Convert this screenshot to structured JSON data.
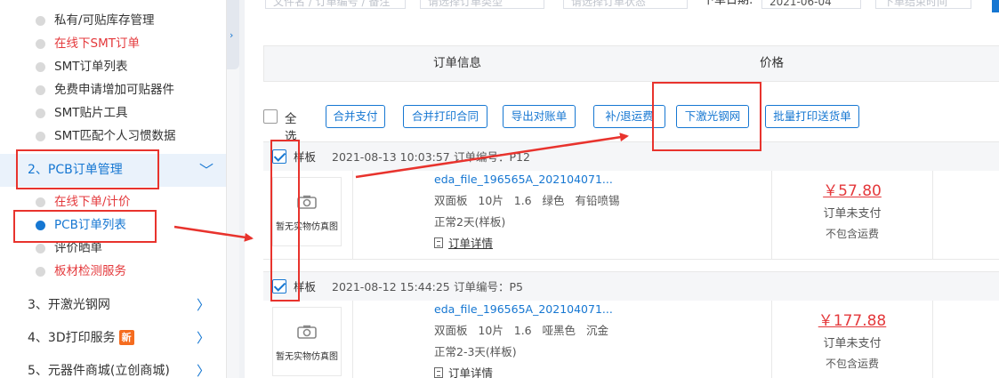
{
  "sidebar": {
    "submenu_top": [
      {
        "label": "私有/可贴库存管理"
      },
      {
        "label": "在线下SMT订单"
      },
      {
        "label": "SMT订单列表"
      },
      {
        "label": "免费申请增加可贴器件"
      },
      {
        "label": "SMT贴片工具"
      },
      {
        "label": "SMT匹配个人习惯数据"
      }
    ],
    "pcb_group": {
      "label": "2、PCB订单管理"
    },
    "pcb_items": [
      {
        "label": "在线下单/计价"
      },
      {
        "label": "PCB订单列表"
      },
      {
        "label": "评价晒单"
      },
      {
        "label": "板材检测服务"
      }
    ],
    "groups": [
      {
        "label": "3、开激光钢网"
      },
      {
        "label": "4、3D打印服务",
        "badge": "新"
      },
      {
        "label": "5、元器件商城(立创商城)"
      }
    ]
  },
  "filters": {
    "search_placeholder": "文件名 / 订单编号 / 备注",
    "type_placeholder": "请选择订单类型",
    "status_placeholder": "请选择订单状态",
    "date_label": "下单日期:",
    "date_value": "2021-06-04",
    "end_placeholder": "下单结束时间"
  },
  "table_header": {
    "order_info": "订单信息",
    "price": "价格"
  },
  "toolbar": {
    "select_all": "全选",
    "buttons": [
      "合并支付",
      "合并打印合同",
      "导出对账单",
      "补/退运费",
      "下激光钢网",
      "批量打印送货单"
    ]
  },
  "orders": [
    {
      "type": "样板",
      "time": "2021-08-13 10:03:57",
      "order_no_label": "订单编号：P12",
      "thumb_caption": "暂无实物仿真图",
      "file": "eda_file_196565A_202104071...",
      "spec": "双面板   10片   1.6   绿色   有铅喷锡",
      "delivery": "正常2天(样板)",
      "detail": "订单详情",
      "price": "￥57.80",
      "status": "订单未支付",
      "note": "不包含运费"
    },
    {
      "type": "样板",
      "time": "2021-08-12 15:44:25",
      "order_no_label": "订单编号：P5",
      "thumb_caption": "暂无实物仿真图",
      "file": "eda_file_196565A_202104071...",
      "spec": "双面板   10片   1.6   哑黑色   沉金",
      "delivery": "正常2-3天(样板)",
      "detail": "订单详情",
      "price": "￥177.88",
      "status": "订单未支付",
      "note": "不包含运费"
    }
  ],
  "colors": {
    "accent": "#1677d2",
    "danger": "#e4393c",
    "annotation": "#e8332d"
  }
}
